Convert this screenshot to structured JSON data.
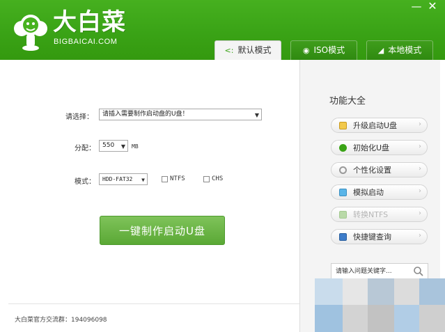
{
  "app": {
    "brand_cn": "大白菜",
    "brand_en": "BIGBAICAI.COM"
  },
  "window_controls": {
    "minimize": "—",
    "close": "✕"
  },
  "tabs": [
    {
      "label": "默认模式",
      "icon": "share-icon",
      "active": true
    },
    {
      "label": "ISO模式",
      "icon": "disc-icon",
      "active": false
    },
    {
      "label": "本地模式",
      "icon": "wifi-icon",
      "active": false
    }
  ],
  "form": {
    "select_label": "请选择：",
    "select_value": "请插入需要制作启动盘的U盘！",
    "alloc_label": "分配：",
    "alloc_value": "550",
    "alloc_unit": "MB",
    "mode_label": "模式：",
    "mode_value": "HDD-FAT32",
    "ntfs_label": "NTFS",
    "chs_label": "CHS",
    "make_button": "一键制作启动U盘"
  },
  "footer": {
    "text": "大白菜官方交流群：194096098"
  },
  "sidebar": {
    "title": "功能大全",
    "items": [
      {
        "label": "升级启动U盘",
        "icon": "upgrade-icon",
        "enabled": true
      },
      {
        "label": "初始化U盘",
        "icon": "init-icon",
        "enabled": true
      },
      {
        "label": "个性化设置",
        "icon": "settings-icon",
        "enabled": true
      },
      {
        "label": "模拟启动",
        "icon": "simulate-icon",
        "enabled": true
      },
      {
        "label": "转换NTFS",
        "icon": "convert-icon",
        "enabled": false
      },
      {
        "label": "快捷键查询",
        "icon": "book-icon",
        "enabled": true
      }
    ],
    "search_placeholder": "请输入问题关键字..."
  },
  "colors": {
    "brand_green": "#3aa316",
    "button_green": "#6cb746"
  }
}
